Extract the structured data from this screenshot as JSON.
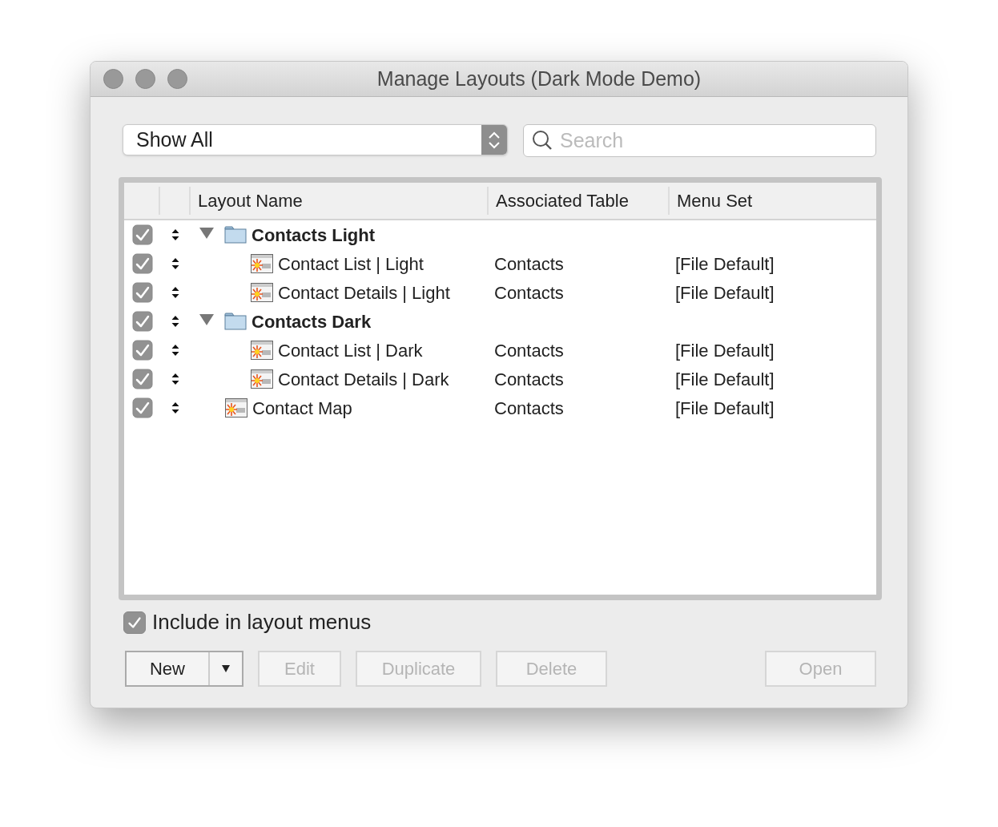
{
  "window": {
    "title": "Manage Layouts (Dark Mode Demo)"
  },
  "filter": {
    "value": "Show All"
  },
  "search": {
    "placeholder": "Search"
  },
  "table": {
    "columns": [
      "Layout Name",
      "Associated Table",
      "Menu Set"
    ],
    "rows": [
      {
        "kind": "folder",
        "name": "Contacts Light",
        "checked": true,
        "expanded": true,
        "children": [
          {
            "kind": "layout",
            "name": "Contact List | Light",
            "table": "Contacts",
            "menu_set": "[File Default]",
            "checked": true
          },
          {
            "kind": "layout",
            "name": "Contact Details | Light",
            "table": "Contacts",
            "menu_set": "[File Default]",
            "checked": true
          }
        ]
      },
      {
        "kind": "folder",
        "name": "Contacts Dark",
        "checked": true,
        "expanded": true,
        "children": [
          {
            "kind": "layout",
            "name": "Contact List | Dark",
            "table": "Contacts",
            "menu_set": "[File Default]",
            "checked": true
          },
          {
            "kind": "layout",
            "name": "Contact Details | Dark",
            "table": "Contacts",
            "menu_set": "[File Default]",
            "checked": true
          }
        ]
      },
      {
        "kind": "layout",
        "name": "Contact Map",
        "table": "Contacts",
        "menu_set": "[File Default]",
        "checked": true
      }
    ]
  },
  "include_option": {
    "label": "Include in layout menus",
    "checked": true
  },
  "buttons": [
    {
      "kind": "split",
      "label": "New",
      "disabled": false
    },
    {
      "kind": "plain",
      "label": "Edit",
      "disabled": true
    },
    {
      "kind": "plain",
      "label": "Duplicate",
      "disabled": true
    },
    {
      "kind": "plain",
      "label": "Delete",
      "disabled": true
    },
    {
      "kind": "spacer_plain",
      "label": "Open",
      "disabled": true
    }
  ]
}
